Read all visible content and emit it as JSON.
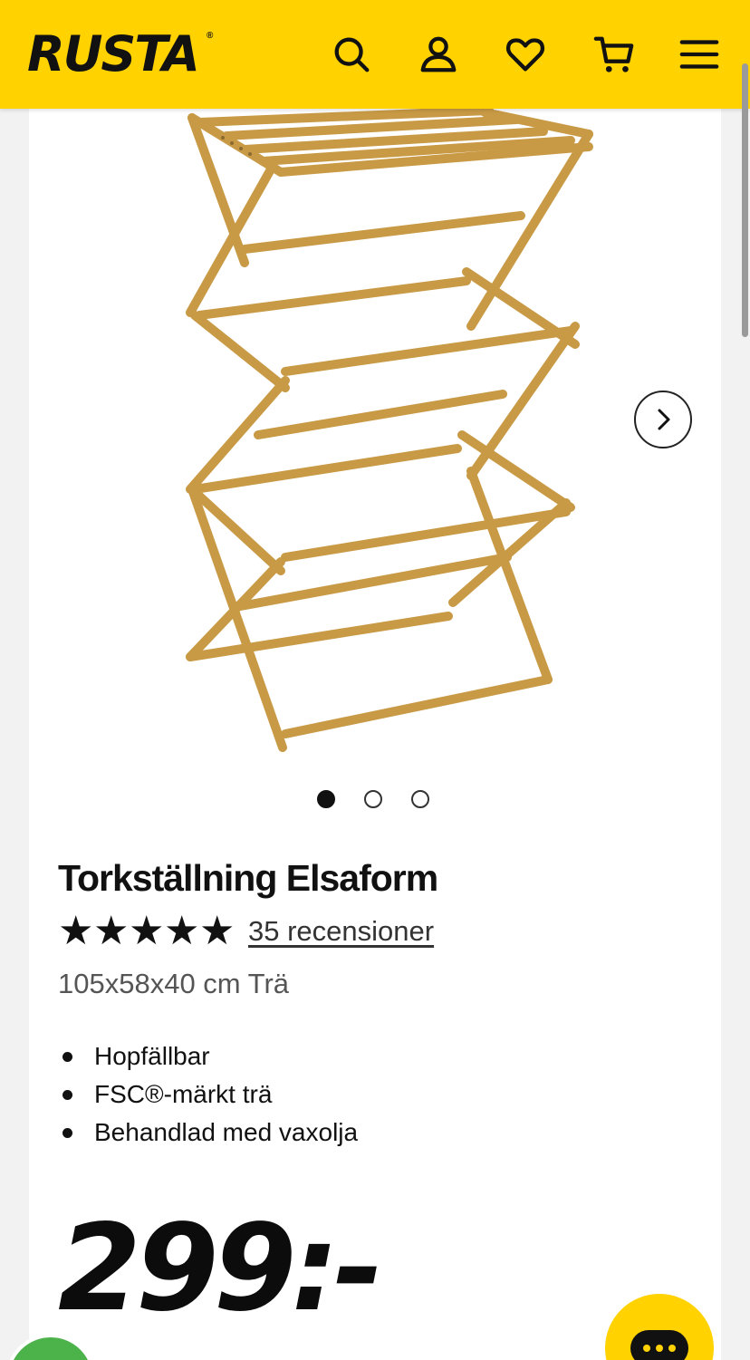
{
  "header": {
    "logo": "RUSTA",
    "logo_mark": "®",
    "icons": [
      "search-icon",
      "account-icon",
      "wishlist-heart-icon",
      "cart-icon",
      "menu-icon"
    ],
    "brand_color": "#ffd200"
  },
  "gallery": {
    "slide_count": 3,
    "active_slide": 1
  },
  "product": {
    "title": "Torkställning Elsaform",
    "rating_stars": 5,
    "reviews_label": "35 recensioner",
    "dimensions": "105x58x40 cm Trä",
    "features": [
      "Hopfällbar",
      "FSC®-märkt trä",
      "Behandlad med vaxolja"
    ],
    "price": "299:-"
  }
}
